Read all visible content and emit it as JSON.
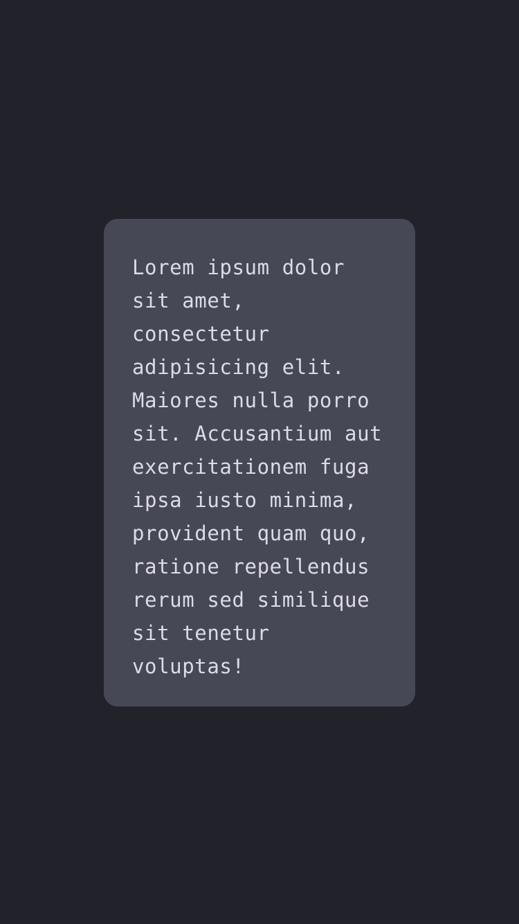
{
  "card": {
    "lines": [
      "Lorem ipsum dolor",
      "sit amet,",
      "consectetur",
      "adipisicing elit.",
      "Maiores nulla porro",
      "sit. Accusantium aut",
      "exercitationem fuga",
      "ipsa iusto minima,",
      "provident quam quo,",
      "ratione repellendus",
      "rerum sed similique",
      "sit tenetur",
      "voluptas!"
    ]
  },
  "colors": {
    "background": "#22222b",
    "card": "#464856",
    "text": "#dcdce6"
  }
}
